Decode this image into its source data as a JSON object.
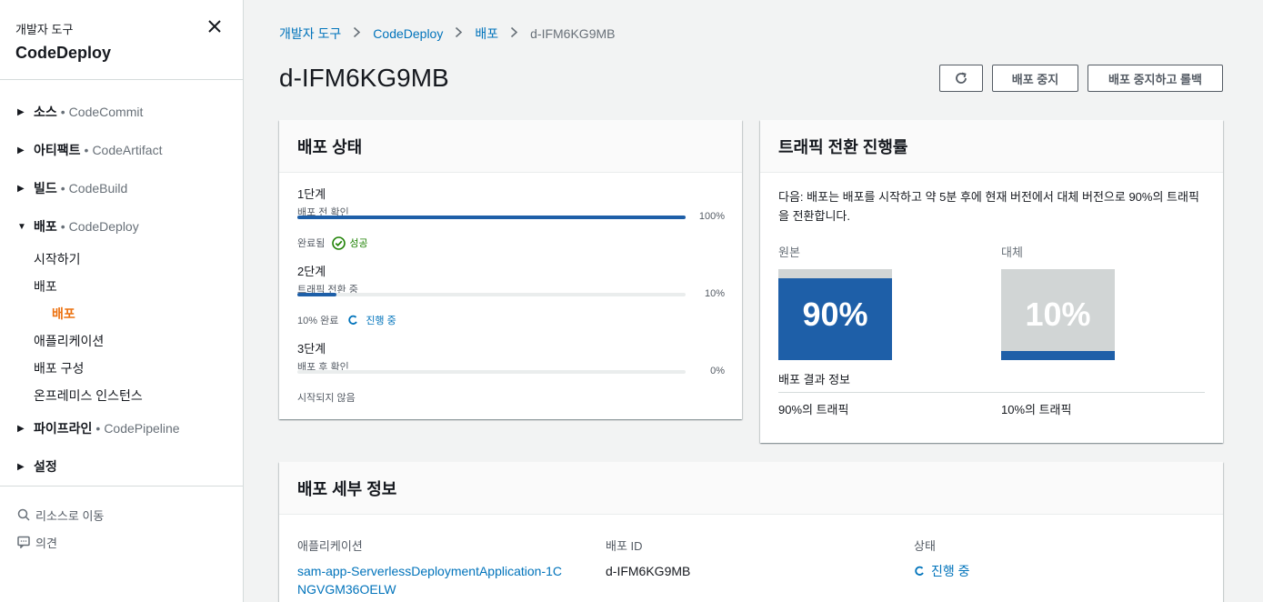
{
  "sidebar": {
    "subtitle": "개발자 도구",
    "title": "CodeDeploy",
    "groups": [
      {
        "label": "소스",
        "sep": "•",
        "service": "CodeCommit"
      },
      {
        "label": "아티팩트",
        "sep": "•",
        "service": "CodeArtifact"
      },
      {
        "label": "빌드",
        "sep": "•",
        "service": "CodeBuild"
      },
      {
        "label": "배포",
        "sep": "•",
        "service": "CodeDeploy"
      },
      {
        "label": "파이프라인",
        "sep": "•",
        "service": "CodePipeline"
      },
      {
        "label": "설정",
        "sep": "",
        "service": ""
      }
    ],
    "deploy_items": [
      "시작하기",
      "배포",
      "배포",
      "애플리케이션",
      "배포 구성",
      "온프레미스 인스턴스"
    ],
    "footer": {
      "goto": "리소스로 이동",
      "feedback": "의견"
    }
  },
  "breadcrumb": {
    "items": [
      "개발자 도구",
      "CodeDeploy",
      "배포"
    ],
    "current": "d-IFM6KG9MB"
  },
  "page": {
    "title": "d-IFM6KG9MB"
  },
  "actions": {
    "stop": "배포 중지",
    "stop_rollback": "배포 중지하고 롤백"
  },
  "status_card": {
    "title": "배포 상태",
    "stages": [
      {
        "name": "1단계",
        "desc": "배포 전 확인",
        "pct_label": "100%",
        "progress": 1.0,
        "status_text": "완료됨",
        "badge": "성공"
      },
      {
        "name": "2단계",
        "desc": "트래픽 전환 중",
        "pct_label": "10%",
        "progress": 0.1,
        "status_text": "10% 완료",
        "badge": "진행 중"
      },
      {
        "name": "3단계",
        "desc": "배포 후 확인",
        "pct_label": "0%",
        "progress": 0.0,
        "status_text": "시작되지 않음",
        "badge": ""
      }
    ]
  },
  "traffic_card": {
    "title": "트래픽 전환 진행률",
    "desc": "다음: 배포는 배포를 시작하고 약 5분 후에 현재 버전에서 대체 버전으로 90%의 트래픽을 전환합니다.",
    "original": {
      "label": "원본",
      "pct_label": "90%",
      "share": 0.9,
      "traffic": "90%의 트래픽"
    },
    "replacement": {
      "label": "대체",
      "pct_label": "10%",
      "share": 0.1,
      "traffic": "10%의 트래픽"
    },
    "info_title": "배포 결과 정보"
  },
  "details_card": {
    "title": "배포 세부 정보",
    "app_label": "애플리케이션",
    "app_value": "sam-app-ServerlessDeploymentApplication-1CNGVGM36OELW",
    "id_label": "배포 ID",
    "id_value": "d-IFM6KG9MB",
    "status_label": "상태",
    "status_value": "진행 중"
  },
  "colors": {
    "accent": "#0073bb",
    "brand_orange": "#ec7211",
    "success": "#1d8102",
    "bar": "#1e5fa8",
    "gray_box": "#d1d5d5"
  }
}
